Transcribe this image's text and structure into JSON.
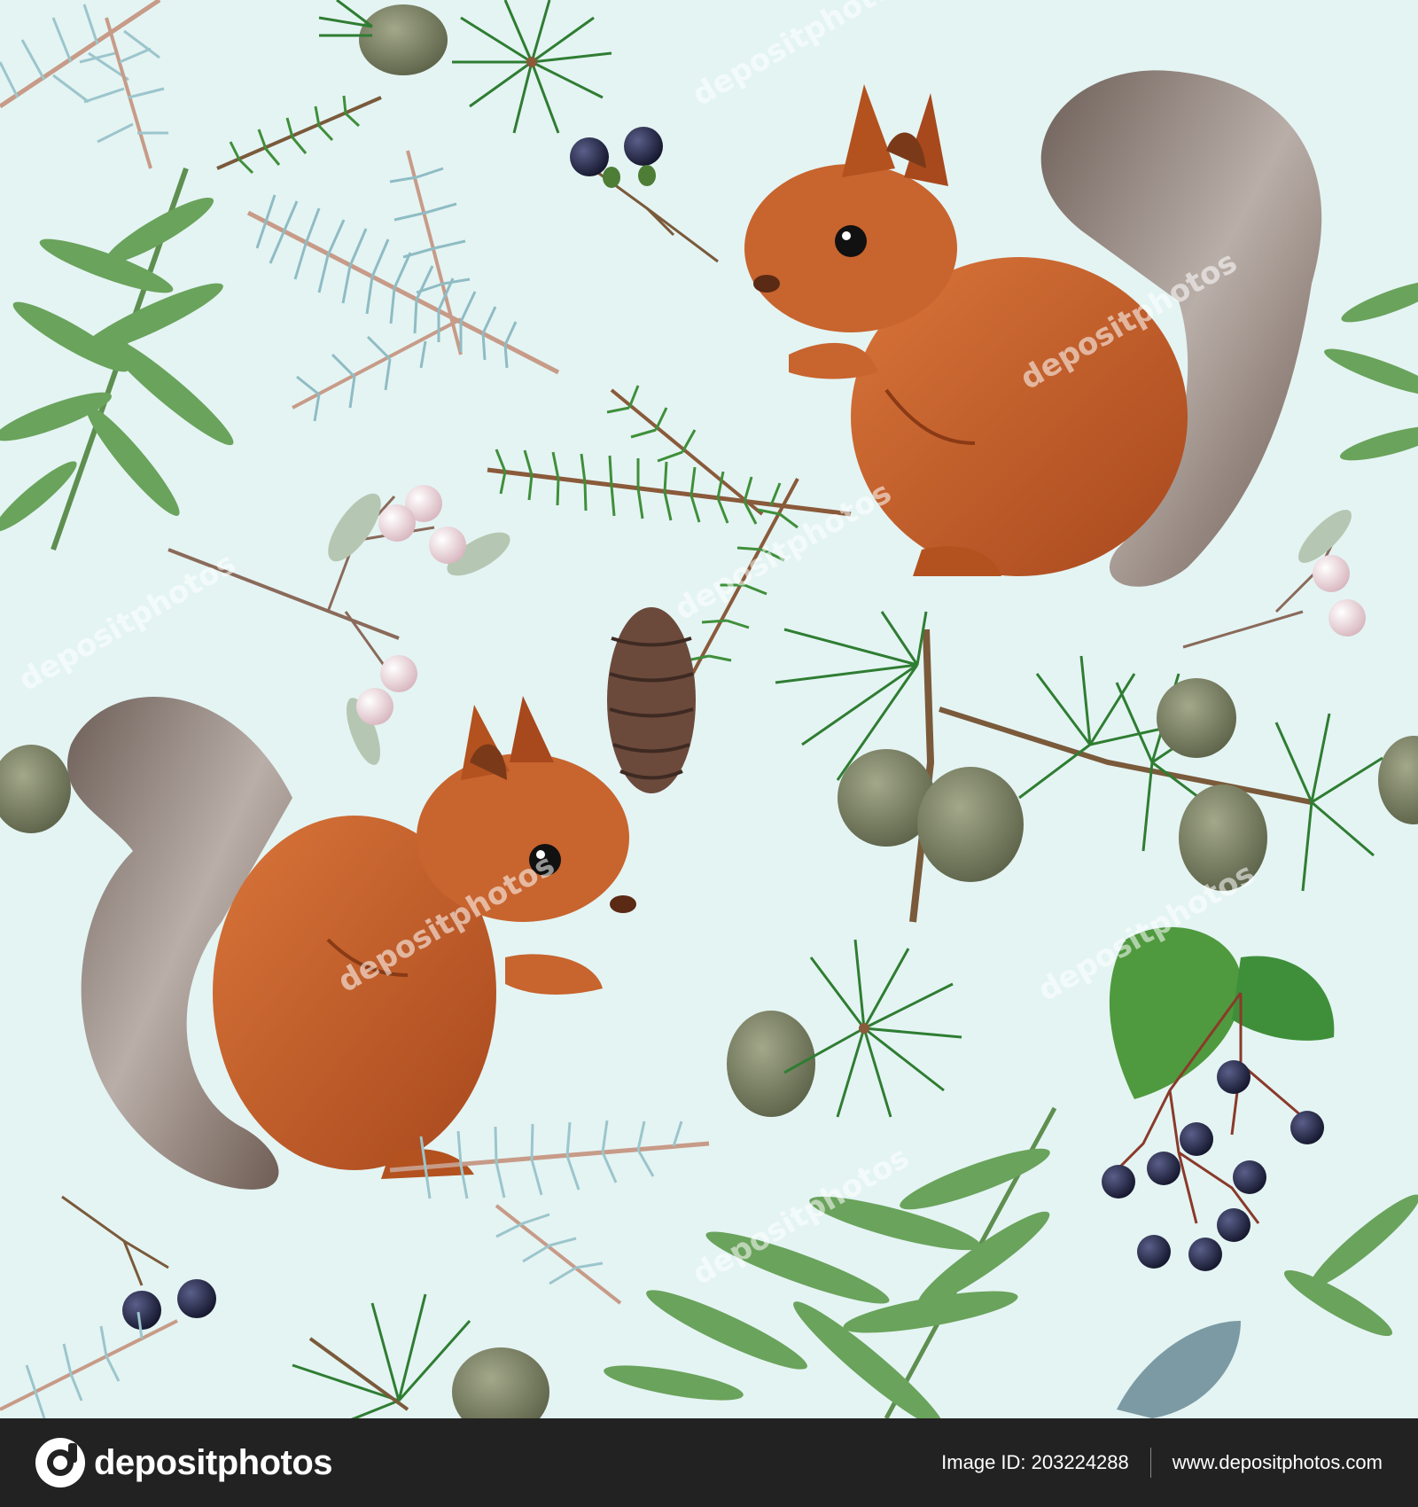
{
  "image": {
    "background": "#e4f4f3",
    "watermark": "depositphotos"
  },
  "footer": {
    "brand": "depositphotos",
    "image_id": "Image ID: 203224288",
    "site": "www.depositphotos.com",
    "background": "#222222"
  },
  "colors": {
    "squirrel_fur": "#c8642e",
    "tail_grey": "#8a7c74",
    "spruce_green": "#3f8f3a",
    "blue_spruce": "#8fbcc4",
    "thuja_green": "#6aa35c",
    "cone_brown": "#6b4a3c",
    "berry_dark": "#1f2140",
    "berry_pink": "#f0d6dc"
  }
}
